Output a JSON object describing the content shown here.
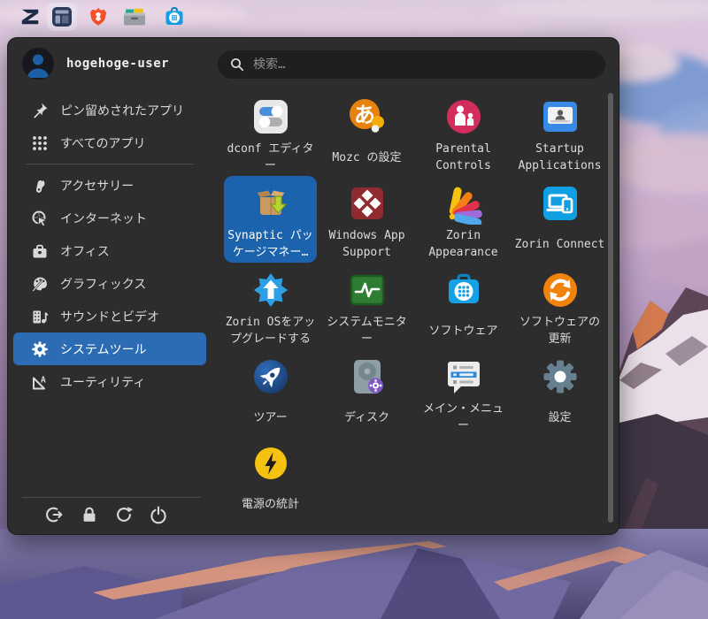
{
  "taskbar": {
    "icons": [
      {
        "name": "zorin-logo"
      },
      {
        "name": "zorin-menu",
        "active": true
      },
      {
        "name": "brave-browser"
      },
      {
        "name": "file-manager"
      },
      {
        "name": "software-store"
      }
    ]
  },
  "menu": {
    "user": {
      "name": "hogehoge-user"
    },
    "search": {
      "placeholder": "検索…"
    },
    "sidebar": {
      "views": [
        {
          "label": "ピン留めされたアプリ",
          "icon": "pin-icon"
        },
        {
          "label": "すべてのアプリ",
          "icon": "all-apps-grid-icon"
        }
      ],
      "categories": [
        {
          "label": "アクセサリー",
          "icon": "accessories-icon"
        },
        {
          "label": "インターネット",
          "icon": "internet-icon"
        },
        {
          "label": "オフィス",
          "icon": "office-icon"
        },
        {
          "label": "グラフィックス",
          "icon": "graphics-icon"
        },
        {
          "label": "サウンドとビデオ",
          "icon": "sound-video-icon"
        },
        {
          "label": "システムツール",
          "icon": "system-tools-icon",
          "selected": true
        },
        {
          "label": "ユーティリティ",
          "icon": "utilities-icon"
        }
      ],
      "session": [
        {
          "name": "logout-button"
        },
        {
          "name": "lock-button"
        },
        {
          "name": "restart-button"
        },
        {
          "name": "power-button"
        }
      ]
    },
    "apps": [
      {
        "label": "dconf エディター",
        "icon": "dconf-editor-icon"
      },
      {
        "label": "Mozc の設定",
        "icon": "mozc-settings-icon"
      },
      {
        "label": "Parental Controls",
        "icon": "parental-controls-icon"
      },
      {
        "label": "Startup Applications",
        "icon": "startup-applications-icon"
      },
      {
        "label": "Synaptic パッケージマネー…",
        "icon": "synaptic-icon",
        "selected": true
      },
      {
        "label": "Windows App Support",
        "icon": "windows-app-support-icon"
      },
      {
        "label": "Zorin Appearance",
        "icon": "zorin-appearance-icon"
      },
      {
        "label": "Zorin Connect",
        "icon": "zorin-connect-icon"
      },
      {
        "label": "Zorin OSをアップグレードする",
        "icon": "zorin-upgrade-icon"
      },
      {
        "label": "システムモニター",
        "icon": "system-monitor-icon"
      },
      {
        "label": "ソフトウェア",
        "icon": "software-icon"
      },
      {
        "label": "ソフトウェアの更新",
        "icon": "software-update-icon"
      },
      {
        "label": "ツアー",
        "icon": "tour-icon"
      },
      {
        "label": "ディスク",
        "icon": "disks-icon"
      },
      {
        "label": "メイン・メニュー",
        "icon": "main-menu-icon"
      },
      {
        "label": "設定",
        "icon": "settings-gear-icon"
      },
      {
        "label": "電源の統計",
        "icon": "power-statistics-icon"
      }
    ],
    "colors": {
      "accent": "#2c6cb5",
      "selected_tile": "#1c63ae",
      "panel": "#2d2d2d"
    }
  }
}
